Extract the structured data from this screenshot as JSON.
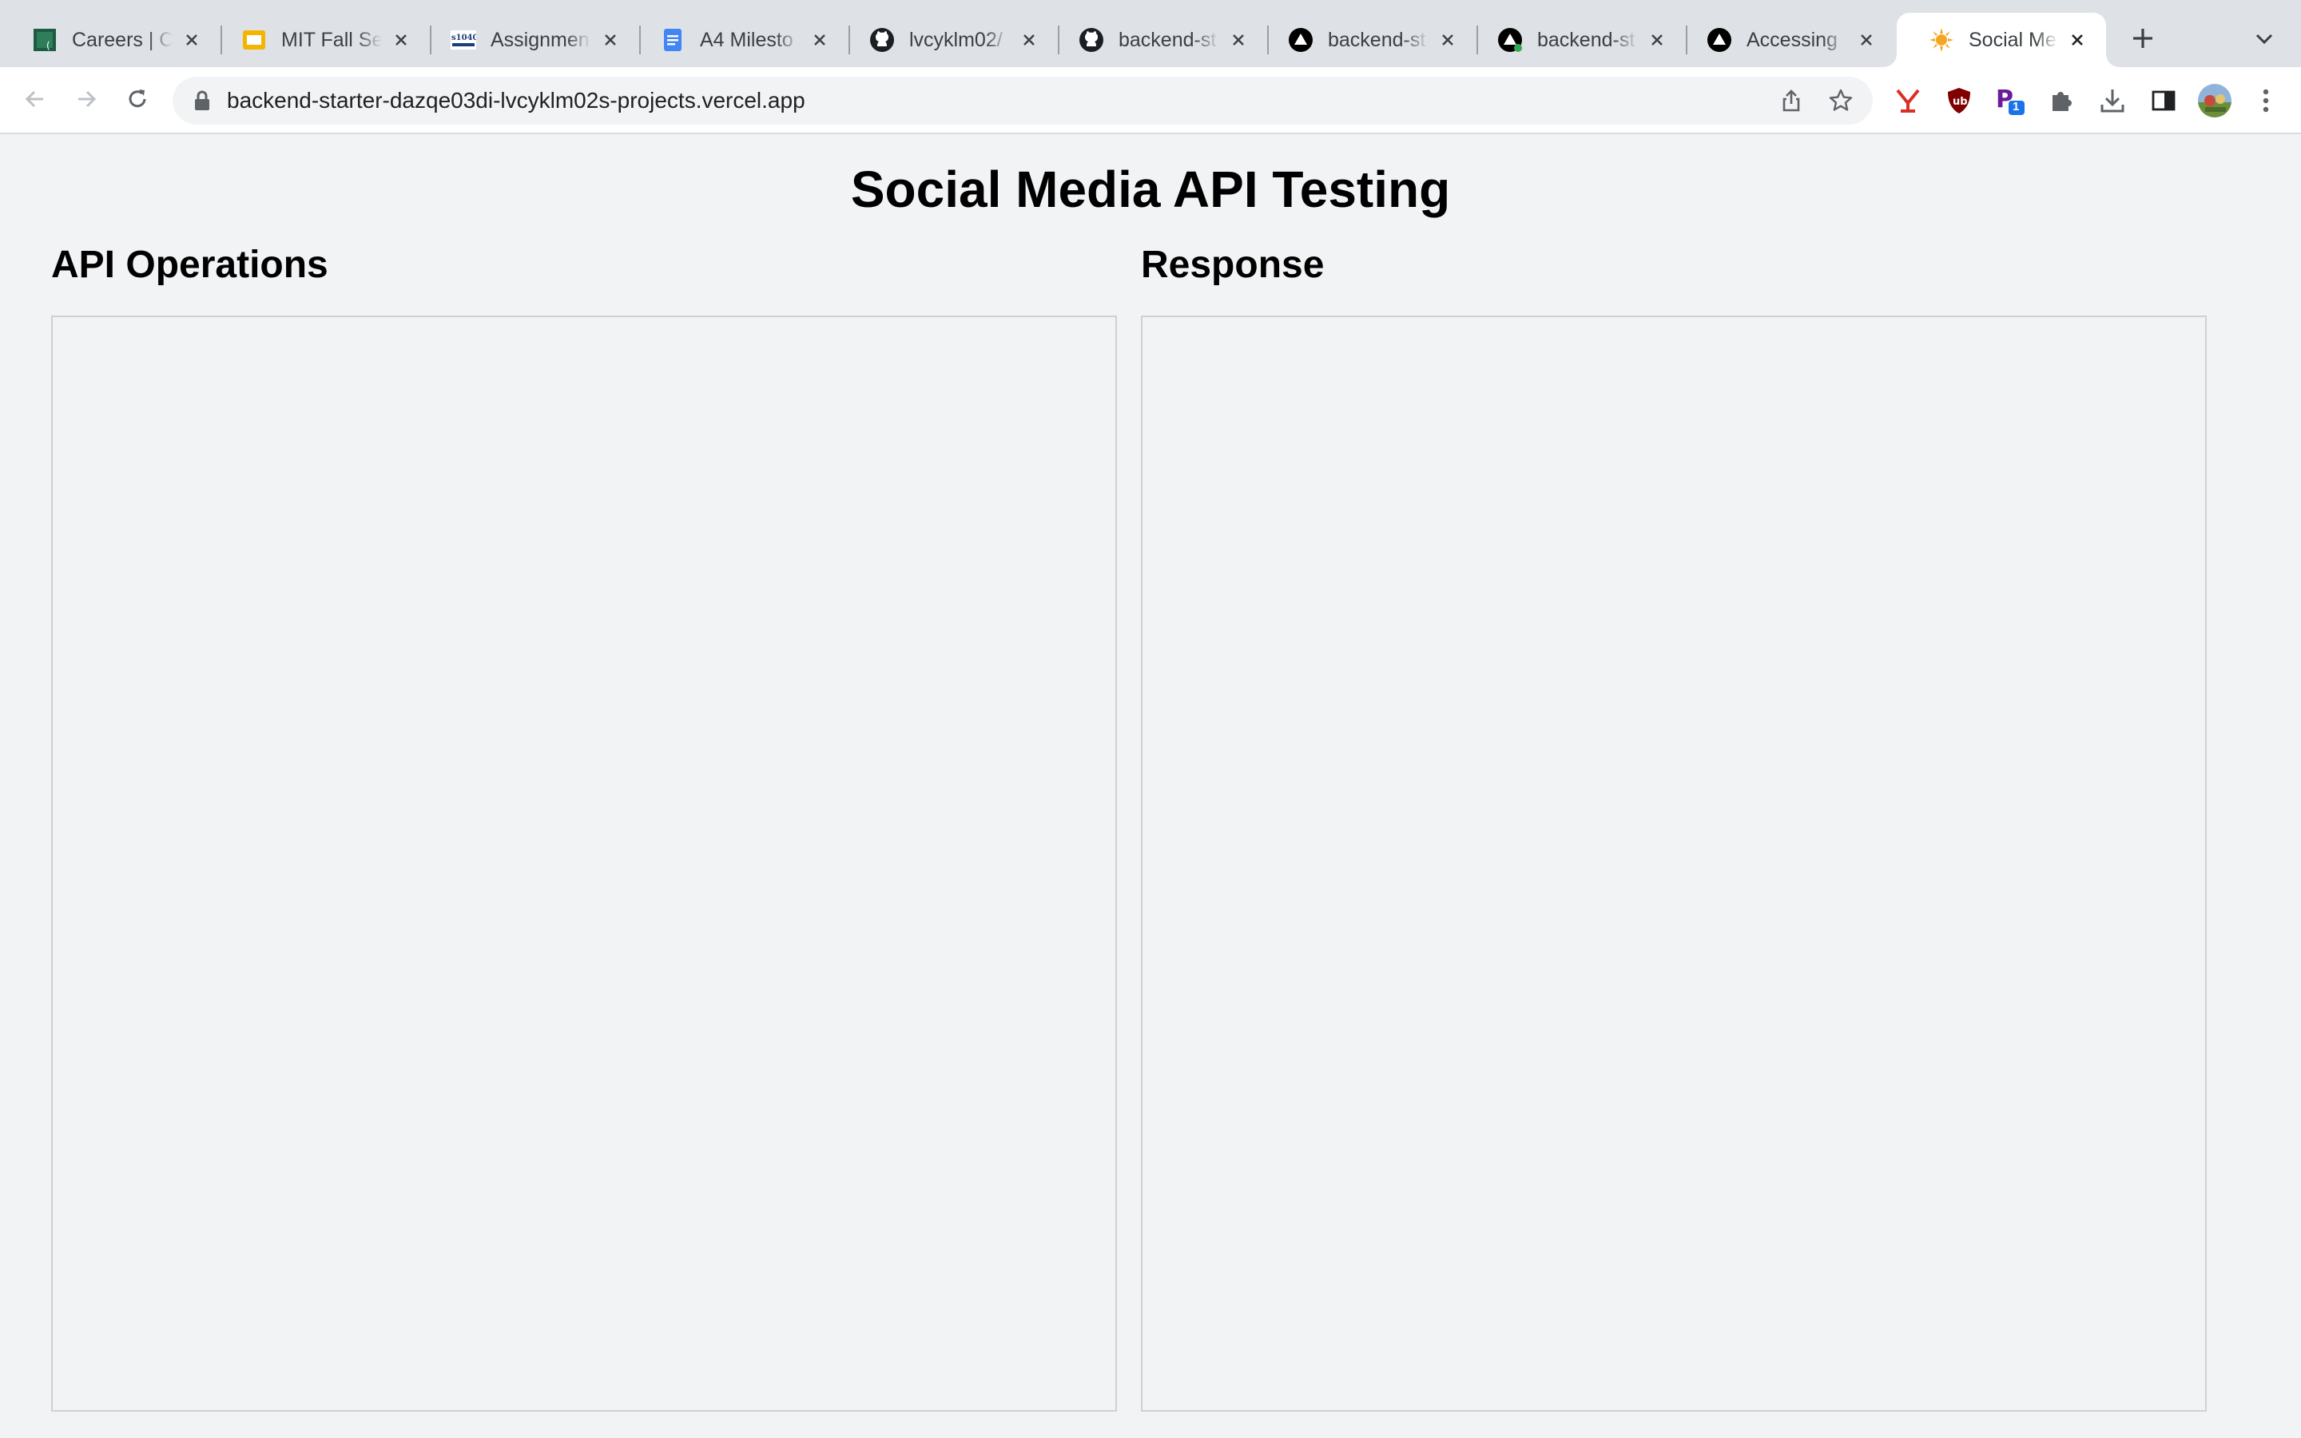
{
  "browser": {
    "tabs": [
      {
        "title": "Careers | C",
        "icon": "careers-icon",
        "active": false
      },
      {
        "title": "MIT Fall Se",
        "icon": "slides-icon",
        "active": false
      },
      {
        "title": "Assignmen",
        "icon": "s1040-icon",
        "active": false
      },
      {
        "title": "A4 Milesto",
        "icon": "docs-icon",
        "active": false
      },
      {
        "title": "lvcyklm02/",
        "icon": "github-icon",
        "active": false
      },
      {
        "title": "backend-st",
        "icon": "github-icon",
        "active": false
      },
      {
        "title": "backend-st",
        "icon": "vercel-icon",
        "active": false
      },
      {
        "title": "backend-st",
        "icon": "vercel-icon",
        "active": false
      },
      {
        "title": "Accessing",
        "icon": "vercel-icon",
        "active": false
      },
      {
        "title": "Social Med",
        "icon": "sun-icon",
        "active": true
      }
    ],
    "url": "backend-starter-dazqe03di-lvcyklm02s-projects.vercel.app",
    "extension_badge": "1",
    "colors": {
      "tabstrip": "#dee1e6",
      "toolbar": "#ffffff",
      "omnibox": "#f1f3f4"
    }
  },
  "page": {
    "title": "Social Media API Testing",
    "left_heading": "API Operations",
    "right_heading": "Response",
    "background": "#f2f3f5"
  }
}
